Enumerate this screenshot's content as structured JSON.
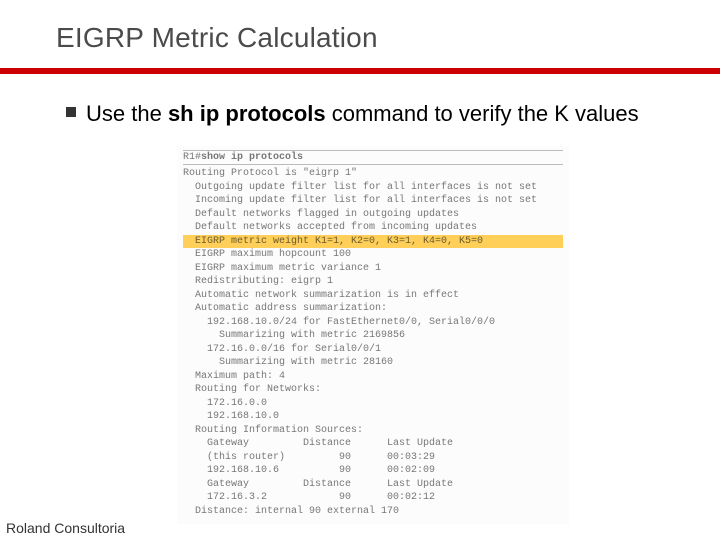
{
  "title": "EIGRP Metric Calculation",
  "bullet": {
    "pre": "Use the ",
    "cmd": "sh ip protocols",
    "post": " command to verify the K values"
  },
  "console": {
    "prompt": "R1#",
    "command": "show ip protocols",
    "lines": [
      "Routing Protocol is \"eigrp 1\"",
      "  Outgoing update filter list for all interfaces is not set",
      "  Incoming update filter list for all interfaces is not set",
      "  Default networks flagged in outgoing updates",
      "  Default networks accepted from incoming updates"
    ],
    "highlight": "  EIGRP metric weight K1=1, K2=0, K3=1, K4=0, K5=0",
    "lines2": [
      "  EIGRP maximum hopcount 100",
      "  EIGRP maximum metric variance 1",
      "  Redistributing: eigrp 1",
      "  Automatic network summarization is in effect",
      "  Automatic address summarization:",
      "    192.168.10.0/24 for FastEthernet0/0, Serial0/0/0",
      "      Summarizing with metric 2169856",
      "    172.16.0.0/16 for Serial0/0/1",
      "      Summarizing with metric 28160",
      "  Maximum path: 4",
      "  Routing for Networks:",
      "    172.16.0.0",
      "    192.168.10.0",
      "  Routing Information Sources:",
      "    Gateway         Distance      Last Update",
      "    (this router)         90      00:03:29",
      "    192.168.10.6          90      00:02:09",
      "    Gateway         Distance      Last Update",
      "    172.16.3.2            90      00:02:12",
      "  Distance: internal 90 external 170"
    ]
  },
  "footer": "Roland Consultoria"
}
